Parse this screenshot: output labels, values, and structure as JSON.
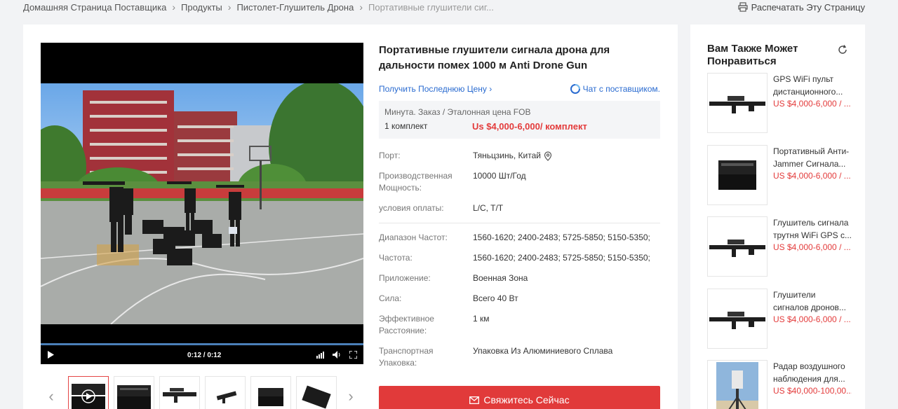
{
  "breadcrumb": {
    "items": [
      "Домашняя Страница Поставщика",
      "Продукты",
      "Пистолет-Глушитель Дрона",
      "Портативные глушители сиг..."
    ]
  },
  "print_label": "Распечатать Эту Страницу",
  "video": {
    "time": "0:12 / 0:12"
  },
  "product": {
    "title": "Портативные глушители сигнала дрона для дальности помех 1000 м Anti Drone Gun",
    "get_price": "Получить Последнюю Цену",
    "chat": "Чат с поставщиком.",
    "price_label": "Минута. Заказ / Эталонная цена FOB",
    "min_order": "1 комплект",
    "price": "Us $4,000-6,000/ комплект",
    "specs_top": [
      {
        "k": "Порт:",
        "v": "Тяньцзинь, Китай"
      },
      {
        "k": "Производственная Мощность:",
        "v": "10000 Шт/Год"
      },
      {
        "k": "условия оплаты:",
        "v": "L/C, T/T"
      }
    ],
    "specs_bottom": [
      {
        "k": "Диапазон Частот:",
        "v": "1560-1620; 2400-2483; 5725-5850; 5150-5350;"
      },
      {
        "k": "Частота:",
        "v": "1560-1620; 2400-2483; 5725-5850; 5150-5350;"
      },
      {
        "k": "Приложение:",
        "v": "Военная Зона"
      },
      {
        "k": "Сила:",
        "v": "Всего 40 Вт"
      },
      {
        "k": "Эффективное Расстояние:",
        "v": "1 км"
      },
      {
        "k": "Транспортная Упаковка:",
        "v": "Упаковка Из Алюминиевого Сплава"
      }
    ],
    "contact_label": "Свяжитесь Сейчас"
  },
  "side": {
    "title": "Вам Также Может Понравиться",
    "items": [
      {
        "name": "GPS WiFi пульт дистанционного...",
        "price": "US $4,000-6,000 / ..."
      },
      {
        "name": "Портативный Анти-Jammer Сигнала...",
        "price": "US $4,000-6,000 / ..."
      },
      {
        "name": "Глушитель сигнала трутня WiFi GPS с...",
        "price": "US $4,000-6,000 / ..."
      },
      {
        "name": "Глушители сигналов дронов...",
        "price": "US $4,000-6,000 / ..."
      },
      {
        "name": "Радар воздушного наблюдения для...",
        "price": "US $40,000-100,00..."
      }
    ]
  },
  "colors": {
    "accent_red": "#e13a3a",
    "link_blue": "#2a6bd0"
  }
}
